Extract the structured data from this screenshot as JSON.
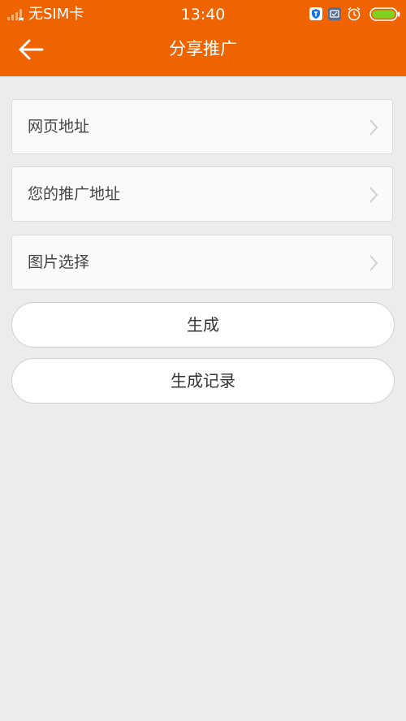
{
  "status_bar": {
    "carrier": "无SIM卡",
    "time": "13:40",
    "icons": [
      "signal-icon",
      "shield-app-icon",
      "app-icon",
      "alarm-icon",
      "battery-icon"
    ]
  },
  "header": {
    "title": "分享推广",
    "back_icon": "back-arrow-icon",
    "color": "#ef6400"
  },
  "form": {
    "rows": [
      {
        "label": "网页地址"
      },
      {
        "label": "您的推广地址"
      },
      {
        "label": "图片选择"
      }
    ]
  },
  "actions": {
    "generate": "生成",
    "history": "生成记录"
  }
}
